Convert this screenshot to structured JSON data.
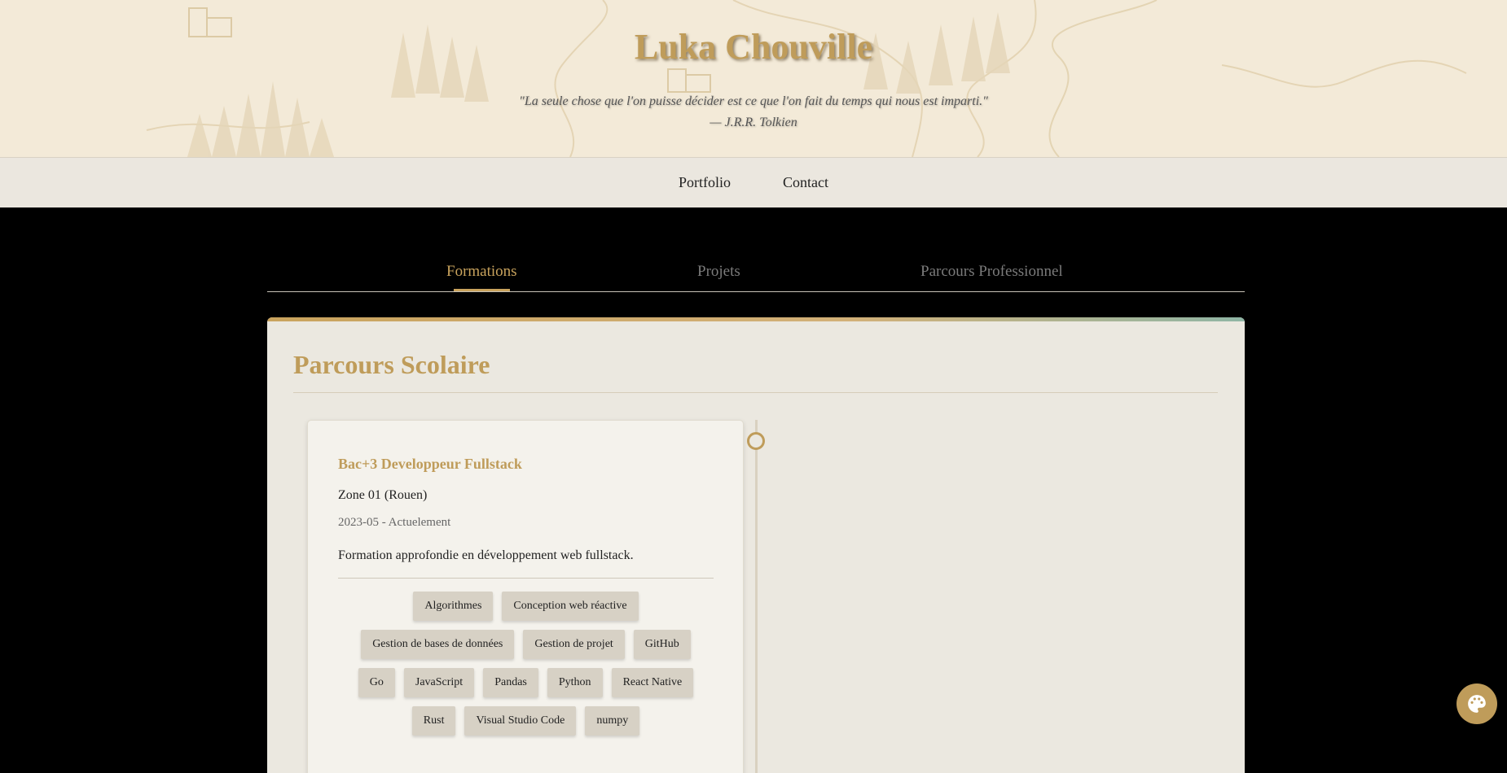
{
  "header": {
    "title": "Luka Chouville",
    "quote": "\"La seule chose que l'on puisse décider est ce que l'on fait du temps qui nous est imparti.\"",
    "quote_author": "— J.R.R. Tolkien"
  },
  "nav": {
    "items": [
      {
        "label": "Portfolio"
      },
      {
        "label": "Contact"
      }
    ]
  },
  "tabs": {
    "items": [
      {
        "label": "Formations",
        "active": true
      },
      {
        "label": "Projets",
        "active": false
      },
      {
        "label": "Parcours Professionnel",
        "active": false
      }
    ]
  },
  "section": {
    "title": "Parcours Scolaire"
  },
  "formation": {
    "title": "Bac+3 Developpeur Fullstack",
    "school": "Zone 01 (Rouen)",
    "dates": "2023-05 - Actuelement",
    "description": "Formation approfondie en développement web fullstack.",
    "skills": [
      [
        "Algorithmes",
        "Conception web réactive"
      ],
      [
        "Gestion de bases de données",
        "Gestion de projet",
        "GitHub"
      ],
      [
        "Go",
        "JavaScript",
        "Pandas",
        "Python",
        "React Native"
      ],
      [
        "Rust",
        "Visual Studio Code",
        "numpy"
      ]
    ]
  },
  "fab": {
    "icon": "palette-icon"
  },
  "colors": {
    "accent": "#bf9c5a",
    "header_bg": "#f3ead8",
    "panel_bg": "#ebe8e0",
    "tag_bg": "#d7d1c5"
  }
}
